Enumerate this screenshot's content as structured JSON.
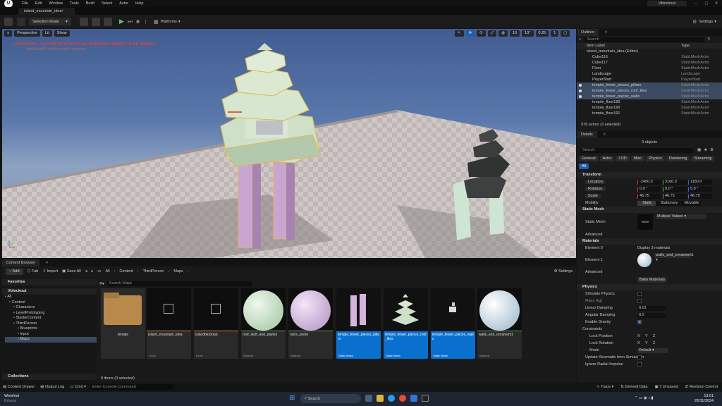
{
  "menubar": {
    "items": [
      "File",
      "Edit",
      "Window",
      "Tools",
      "Build",
      "Select",
      "Actor",
      "Help"
    ],
    "project": "Vblockout"
  },
  "tab": {
    "label": "island_mountain_idea•"
  },
  "toolbar": {
    "mode": "Selection Mode",
    "platforms": "Platforms",
    "settings": "Settings"
  },
  "viewport": {
    "perspective": "Perspective",
    "lit": "Lit",
    "show": "Show",
    "warning": "LANDSCAPE: 1 ACTOR WITH PHYSICAL MATERIALS NEEDS TO BE REBUILT",
    "warning_sub": "InvalidatedConstDerivesnt in progress",
    "right_values": [
      "10",
      "10°",
      "0.25",
      "1"
    ]
  },
  "outliner": {
    "tab": "Outliner",
    "search_placeholder": "Search",
    "col_label": "Item Label",
    "col_type": "Type",
    "items": [
      {
        "label": "island_mountain_idea (Editor)",
        "type": "",
        "sel": false
      },
      {
        "label": "Cube116",
        "type": "StaticMeshActor",
        "sel": false
      },
      {
        "label": "Cube117",
        "type": "StaticMeshActor",
        "sel": false
      },
      {
        "label": "Floor",
        "type": "StaticMeshActor",
        "sel": false
      },
      {
        "label": "Landscape",
        "type": "Landscape",
        "sel": false
      },
      {
        "label": "PlayerStart",
        "type": "PlayerStart",
        "sel": false
      },
      {
        "label": "temple_fewer_pieces_pillars",
        "type": "StaticMeshActor",
        "sel": true
      },
      {
        "label": "temple_fewer_pieces_roof_tiles",
        "type": "StaticMeshActor",
        "sel": true
      },
      {
        "label": "temple_fewer_pieces_walls",
        "type": "StaticMeshActor",
        "sel": true
      },
      {
        "label": "temple_floor189",
        "type": "StaticMeshActor",
        "sel": false
      },
      {
        "label": "temple_floor190",
        "type": "StaticMeshActor",
        "sel": false
      },
      {
        "label": "temple_floor191",
        "type": "StaticMeshActor",
        "sel": false
      }
    ],
    "footer": "978 actors (3 selected)"
  },
  "details": {
    "tab": "Details",
    "objects": "3 objects",
    "search_placeholder": "Search",
    "filters": [
      "General",
      "Actor",
      "LOD",
      "Misc",
      "Physics",
      "Rendering",
      "Streaming",
      "All"
    ],
    "transform": "Transform",
    "location": {
      "label": "Location",
      "x": "-2400.0",
      "y": "3160.0",
      "z": "1180.0"
    },
    "rotation": {
      "label": "Rotation",
      "x": "0.0 °",
      "y": "0.0 °",
      "z": "0.0 °"
    },
    "scale": {
      "label": "Scale",
      "x": "46.75",
      "y": "46.75",
      "z": "46.75"
    },
    "mobility": {
      "label": "Mobility",
      "options": [
        "Static",
        "Stationary",
        "Movable"
      ]
    },
    "static_mesh_sec": "Static Mesh",
    "static_mesh": {
      "label": "Static Mesh",
      "thumb": "None",
      "value": "Multiple Values"
    },
    "advanced": "Advanced",
    "materials_sec": "Materials",
    "element0": {
      "label": "Element 0",
      "value": "Display 3 materials"
    },
    "element1": {
      "label": "Element 1",
      "value": "walls_and_ornament1"
    },
    "advanced2": "Advanced",
    "bake": "Bake Materials",
    "physics_sec": "Physics",
    "simulate": "Simulate Physics",
    "mass": "Mass (kg)",
    "linear_damping": {
      "label": "Linear Damping",
      "value": "0.01"
    },
    "angular_damping": {
      "label": "Angular Damping",
      "value": "0.0"
    },
    "enable_gravity": "Enable Gravity",
    "constraints": "Constraints",
    "lock_position": "Lock Position",
    "lock_rotation": "Lock Rotation",
    "mode": {
      "label": "Mode",
      "value": "Default"
    },
    "update_kinematic": "Update Kinematic from Simulation",
    "ignore_radial_impulse": "Ignore Radial Impulse",
    "xyz": [
      "X",
      "Y",
      "Z"
    ]
  },
  "content_browser": {
    "tab": "Content Browser",
    "add": "Add",
    "fab": "Fab",
    "import": "Import",
    "save_all": "Save All",
    "path": [
      "All",
      "Content",
      "ThirdPerson",
      "Maps"
    ],
    "settings": "Settings",
    "search_placeholder": "Search Maps",
    "favorites": "Favorites",
    "project": "Vblockout",
    "tree": [
      "All",
      "Content",
      "Characters",
      "LevelPrototyping",
      "StarterContent",
      "ThirdPerson",
      "Blueprints",
      "Input",
      "Maps"
    ],
    "collections": "Collections",
    "count": "9 items (3 selected)",
    "assets": [
      {
        "name": "temple",
        "kind": "",
        "sel": false
      },
      {
        "name": "island_mountain_idea",
        "kind": "Level",
        "sel": false
      },
      {
        "name": "islandblockout",
        "kind": "Level",
        "sel": false
      },
      {
        "name": "roof_stuff_and_planks",
        "kind": "Material",
        "sel": false
      },
      {
        "name": "ruins_under",
        "kind": "Material",
        "sel": false
      },
      {
        "name": "temple_fewer_pieces_pillars",
        "kind": "Static Mesh",
        "sel": true
      },
      {
        "name": "temple_fewer_pieces_roof_tiles",
        "kind": "Static Mesh",
        "sel": true
      },
      {
        "name": "temple_fewer_pieces_walls",
        "kind": "Static Mesh",
        "sel": true
      },
      {
        "name": "walls_and_ornament1",
        "kind": "Material",
        "sel": false
      }
    ]
  },
  "statusbar": {
    "content_drawer": "Content Drawer",
    "output_log": "Output Log",
    "cmd": "Cmd",
    "console_placeholder": "Enter Console Command",
    "trace": "Trace",
    "derived_data": "Derived Data",
    "unsaved": "7 Unsaved",
    "revision": "Revision Control"
  },
  "taskbar": {
    "weather": "Weisfrist",
    "weather_sub": "Erhaus",
    "search": "Search",
    "time": "13:01",
    "date": "26/11/2024"
  }
}
